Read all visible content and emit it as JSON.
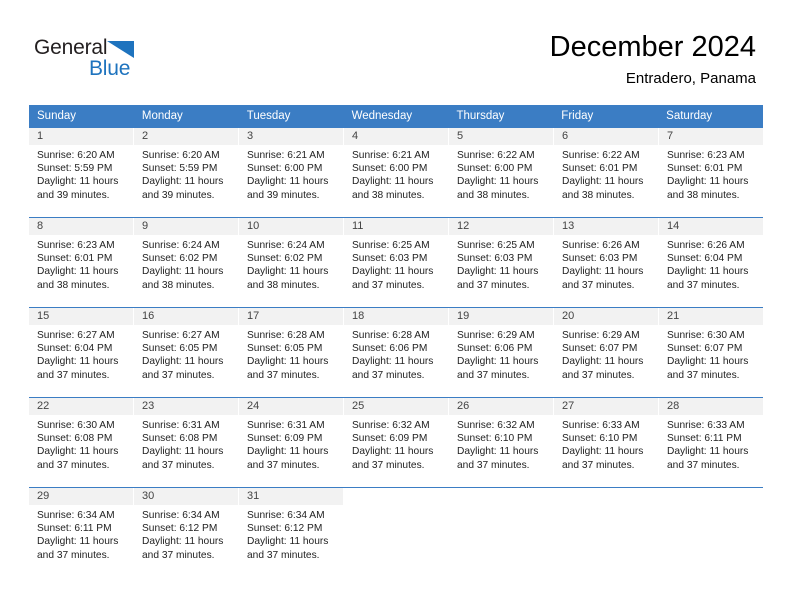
{
  "brand": {
    "name_part1": "General",
    "name_part2": "Blue",
    "accent_color": "#1e73be"
  },
  "header": {
    "month_title": "December 2024",
    "location": "Entradero, Panama"
  },
  "calendar": {
    "header_color": "#3b7dc4",
    "weekdays": [
      "Sunday",
      "Monday",
      "Tuesday",
      "Wednesday",
      "Thursday",
      "Friday",
      "Saturday"
    ],
    "weeks": [
      [
        {
          "day": "1",
          "sunrise": "Sunrise: 6:20 AM",
          "sunset": "Sunset: 5:59 PM",
          "daylight1": "Daylight: 11 hours",
          "daylight2": "and 39 minutes."
        },
        {
          "day": "2",
          "sunrise": "Sunrise: 6:20 AM",
          "sunset": "Sunset: 5:59 PM",
          "daylight1": "Daylight: 11 hours",
          "daylight2": "and 39 minutes."
        },
        {
          "day": "3",
          "sunrise": "Sunrise: 6:21 AM",
          "sunset": "Sunset: 6:00 PM",
          "daylight1": "Daylight: 11 hours",
          "daylight2": "and 39 minutes."
        },
        {
          "day": "4",
          "sunrise": "Sunrise: 6:21 AM",
          "sunset": "Sunset: 6:00 PM",
          "daylight1": "Daylight: 11 hours",
          "daylight2": "and 38 minutes."
        },
        {
          "day": "5",
          "sunrise": "Sunrise: 6:22 AM",
          "sunset": "Sunset: 6:00 PM",
          "daylight1": "Daylight: 11 hours",
          "daylight2": "and 38 minutes."
        },
        {
          "day": "6",
          "sunrise": "Sunrise: 6:22 AM",
          "sunset": "Sunset: 6:01 PM",
          "daylight1": "Daylight: 11 hours",
          "daylight2": "and 38 minutes."
        },
        {
          "day": "7",
          "sunrise": "Sunrise: 6:23 AM",
          "sunset": "Sunset: 6:01 PM",
          "daylight1": "Daylight: 11 hours",
          "daylight2": "and 38 minutes."
        }
      ],
      [
        {
          "day": "8",
          "sunrise": "Sunrise: 6:23 AM",
          "sunset": "Sunset: 6:01 PM",
          "daylight1": "Daylight: 11 hours",
          "daylight2": "and 38 minutes."
        },
        {
          "day": "9",
          "sunrise": "Sunrise: 6:24 AM",
          "sunset": "Sunset: 6:02 PM",
          "daylight1": "Daylight: 11 hours",
          "daylight2": "and 38 minutes."
        },
        {
          "day": "10",
          "sunrise": "Sunrise: 6:24 AM",
          "sunset": "Sunset: 6:02 PM",
          "daylight1": "Daylight: 11 hours",
          "daylight2": "and 38 minutes."
        },
        {
          "day": "11",
          "sunrise": "Sunrise: 6:25 AM",
          "sunset": "Sunset: 6:03 PM",
          "daylight1": "Daylight: 11 hours",
          "daylight2": "and 37 minutes."
        },
        {
          "day": "12",
          "sunrise": "Sunrise: 6:25 AM",
          "sunset": "Sunset: 6:03 PM",
          "daylight1": "Daylight: 11 hours",
          "daylight2": "and 37 minutes."
        },
        {
          "day": "13",
          "sunrise": "Sunrise: 6:26 AM",
          "sunset": "Sunset: 6:03 PM",
          "daylight1": "Daylight: 11 hours",
          "daylight2": "and 37 minutes."
        },
        {
          "day": "14",
          "sunrise": "Sunrise: 6:26 AM",
          "sunset": "Sunset: 6:04 PM",
          "daylight1": "Daylight: 11 hours",
          "daylight2": "and 37 minutes."
        }
      ],
      [
        {
          "day": "15",
          "sunrise": "Sunrise: 6:27 AM",
          "sunset": "Sunset: 6:04 PM",
          "daylight1": "Daylight: 11 hours",
          "daylight2": "and 37 minutes."
        },
        {
          "day": "16",
          "sunrise": "Sunrise: 6:27 AM",
          "sunset": "Sunset: 6:05 PM",
          "daylight1": "Daylight: 11 hours",
          "daylight2": "and 37 minutes."
        },
        {
          "day": "17",
          "sunrise": "Sunrise: 6:28 AM",
          "sunset": "Sunset: 6:05 PM",
          "daylight1": "Daylight: 11 hours",
          "daylight2": "and 37 minutes."
        },
        {
          "day": "18",
          "sunrise": "Sunrise: 6:28 AM",
          "sunset": "Sunset: 6:06 PM",
          "daylight1": "Daylight: 11 hours",
          "daylight2": "and 37 minutes."
        },
        {
          "day": "19",
          "sunrise": "Sunrise: 6:29 AM",
          "sunset": "Sunset: 6:06 PM",
          "daylight1": "Daylight: 11 hours",
          "daylight2": "and 37 minutes."
        },
        {
          "day": "20",
          "sunrise": "Sunrise: 6:29 AM",
          "sunset": "Sunset: 6:07 PM",
          "daylight1": "Daylight: 11 hours",
          "daylight2": "and 37 minutes."
        },
        {
          "day": "21",
          "sunrise": "Sunrise: 6:30 AM",
          "sunset": "Sunset: 6:07 PM",
          "daylight1": "Daylight: 11 hours",
          "daylight2": "and 37 minutes."
        }
      ],
      [
        {
          "day": "22",
          "sunrise": "Sunrise: 6:30 AM",
          "sunset": "Sunset: 6:08 PM",
          "daylight1": "Daylight: 11 hours",
          "daylight2": "and 37 minutes."
        },
        {
          "day": "23",
          "sunrise": "Sunrise: 6:31 AM",
          "sunset": "Sunset: 6:08 PM",
          "daylight1": "Daylight: 11 hours",
          "daylight2": "and 37 minutes."
        },
        {
          "day": "24",
          "sunrise": "Sunrise: 6:31 AM",
          "sunset": "Sunset: 6:09 PM",
          "daylight1": "Daylight: 11 hours",
          "daylight2": "and 37 minutes."
        },
        {
          "day": "25",
          "sunrise": "Sunrise: 6:32 AM",
          "sunset": "Sunset: 6:09 PM",
          "daylight1": "Daylight: 11 hours",
          "daylight2": "and 37 minutes."
        },
        {
          "day": "26",
          "sunrise": "Sunrise: 6:32 AM",
          "sunset": "Sunset: 6:10 PM",
          "daylight1": "Daylight: 11 hours",
          "daylight2": "and 37 minutes."
        },
        {
          "day": "27",
          "sunrise": "Sunrise: 6:33 AM",
          "sunset": "Sunset: 6:10 PM",
          "daylight1": "Daylight: 11 hours",
          "daylight2": "and 37 minutes."
        },
        {
          "day": "28",
          "sunrise": "Sunrise: 6:33 AM",
          "sunset": "Sunset: 6:11 PM",
          "daylight1": "Daylight: 11 hours",
          "daylight2": "and 37 minutes."
        }
      ],
      [
        {
          "day": "29",
          "sunrise": "Sunrise: 6:34 AM",
          "sunset": "Sunset: 6:11 PM",
          "daylight1": "Daylight: 11 hours",
          "daylight2": "and 37 minutes."
        },
        {
          "day": "30",
          "sunrise": "Sunrise: 6:34 AM",
          "sunset": "Sunset: 6:12 PM",
          "daylight1": "Daylight: 11 hours",
          "daylight2": "and 37 minutes."
        },
        {
          "day": "31",
          "sunrise": "Sunrise: 6:34 AM",
          "sunset": "Sunset: 6:12 PM",
          "daylight1": "Daylight: 11 hours",
          "daylight2": "and 37 minutes."
        },
        {
          "day": "",
          "sunrise": "",
          "sunset": "",
          "daylight1": "",
          "daylight2": ""
        },
        {
          "day": "",
          "sunrise": "",
          "sunset": "",
          "daylight1": "",
          "daylight2": ""
        },
        {
          "day": "",
          "sunrise": "",
          "sunset": "",
          "daylight1": "",
          "daylight2": ""
        },
        {
          "day": "",
          "sunrise": "",
          "sunset": "",
          "daylight1": "",
          "daylight2": ""
        }
      ]
    ]
  }
}
